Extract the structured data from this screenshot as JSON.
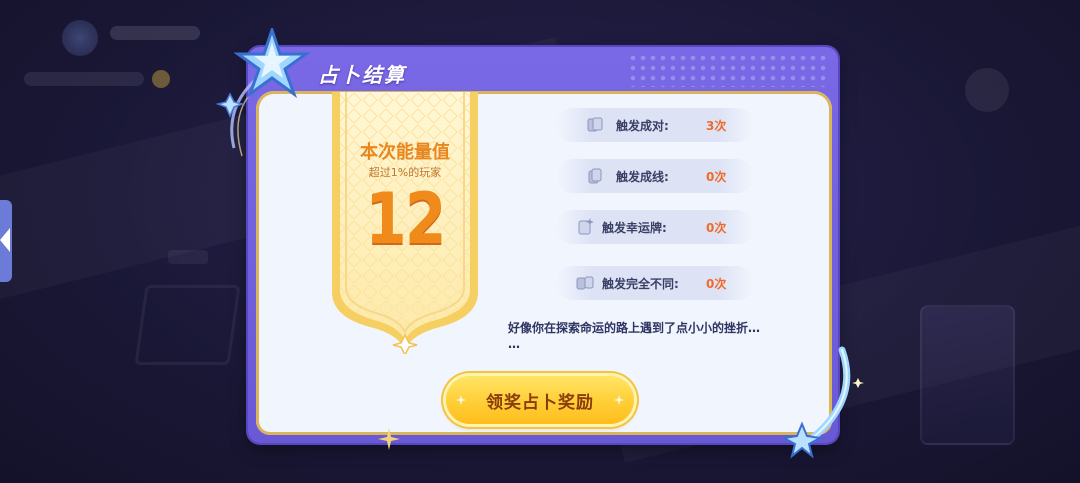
{
  "dialog": {
    "title": "占卜结算"
  },
  "banner": {
    "title": "本次能量值",
    "subtitle": "超过1%的玩家",
    "value": "12"
  },
  "stats": [
    {
      "label": "触发成对:",
      "value": "3次",
      "icon": "card-pair-icon"
    },
    {
      "label": "触发成线:",
      "value": "0次",
      "icon": "card-line-icon"
    },
    {
      "label": "触发幸运牌:",
      "value": "0次",
      "icon": "lucky-card-icon"
    },
    {
      "label": "触发完全不同:",
      "value": "0次",
      "icon": "different-cards-icon"
    }
  ],
  "message": "好像你在探索命运的路上遇到了点小小的挫折…\n…",
  "claim_button": {
    "label": "领奖占卜奖励"
  },
  "colors": {
    "dialog_purple": "#7a69e6",
    "accent_orange": "#f08a1a",
    "value_orange": "#f06b2a",
    "button_yellow": "#ffd03a"
  }
}
